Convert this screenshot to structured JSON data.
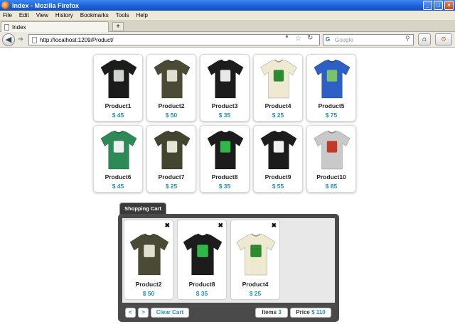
{
  "window": {
    "title": "Index - Mozilla Firefox"
  },
  "menu": {
    "items": [
      "File",
      "Edit",
      "View",
      "History",
      "Bookmarks",
      "Tools",
      "Help"
    ]
  },
  "tabs": {
    "active_label": "Index",
    "new_tab": "+"
  },
  "nav": {
    "url": "http://localhost:1209/Product/",
    "search_placeholder": "Google"
  },
  "products": [
    {
      "name": "Product1",
      "price": "$ 45",
      "color": "#1c1c1c",
      "graphic": "#cfd4cf"
    },
    {
      "name": "Product2",
      "price": "$ 50",
      "color": "#4b4a35",
      "graphic": "#e0e0d0"
    },
    {
      "name": "Product3",
      "price": "$ 35",
      "color": "#1c1c1c",
      "graphic": "#e8e8e8"
    },
    {
      "name": "Product4",
      "price": "$ 25",
      "color": "#efe9d2",
      "graphic": "#2e8a2e"
    },
    {
      "name": "Product5",
      "price": "$ 75",
      "color": "#2d5fc4",
      "graphic": "#7ac36a"
    },
    {
      "name": "Product6",
      "price": "$ 45",
      "color": "#2d8a57",
      "graphic": "#f0f0f0"
    },
    {
      "name": "Product7",
      "price": "$ 25",
      "color": "#44452f",
      "graphic": "#e6e6d6"
    },
    {
      "name": "Product8",
      "price": "$ 35",
      "color": "#1c1c1c",
      "graphic": "#2fb84a"
    },
    {
      "name": "Product9",
      "price": "$ 55",
      "color": "#1c1c1c",
      "graphic": "#f0f0f0"
    },
    {
      "name": "Product10",
      "price": "$ 85",
      "color": "#c9c9c9",
      "graphic": "#c0392b"
    }
  ],
  "cart": {
    "tab_label": "Shopping Cart",
    "items": [
      {
        "name": "Product2",
        "price": "$ 50",
        "color": "#4b4a35",
        "graphic": "#e0e0d0"
      },
      {
        "name": "Product8",
        "price": "$ 35",
        "color": "#1c1c1c",
        "graphic": "#2fb84a"
      },
      {
        "name": "Product4",
        "price": "$ 25",
        "color": "#efe9d2",
        "graphic": "#2e8a2e"
      }
    ],
    "remove_symbol": "✖",
    "prev_label": "<",
    "next_label": ">",
    "clear_label": "Clear Cart",
    "items_label": "Items",
    "items_count": "3",
    "price_label": "Price",
    "price_total": "$ 110"
  },
  "colors": {
    "accent": "#1f8fb8",
    "cart_bg": "#4a4a4a"
  }
}
